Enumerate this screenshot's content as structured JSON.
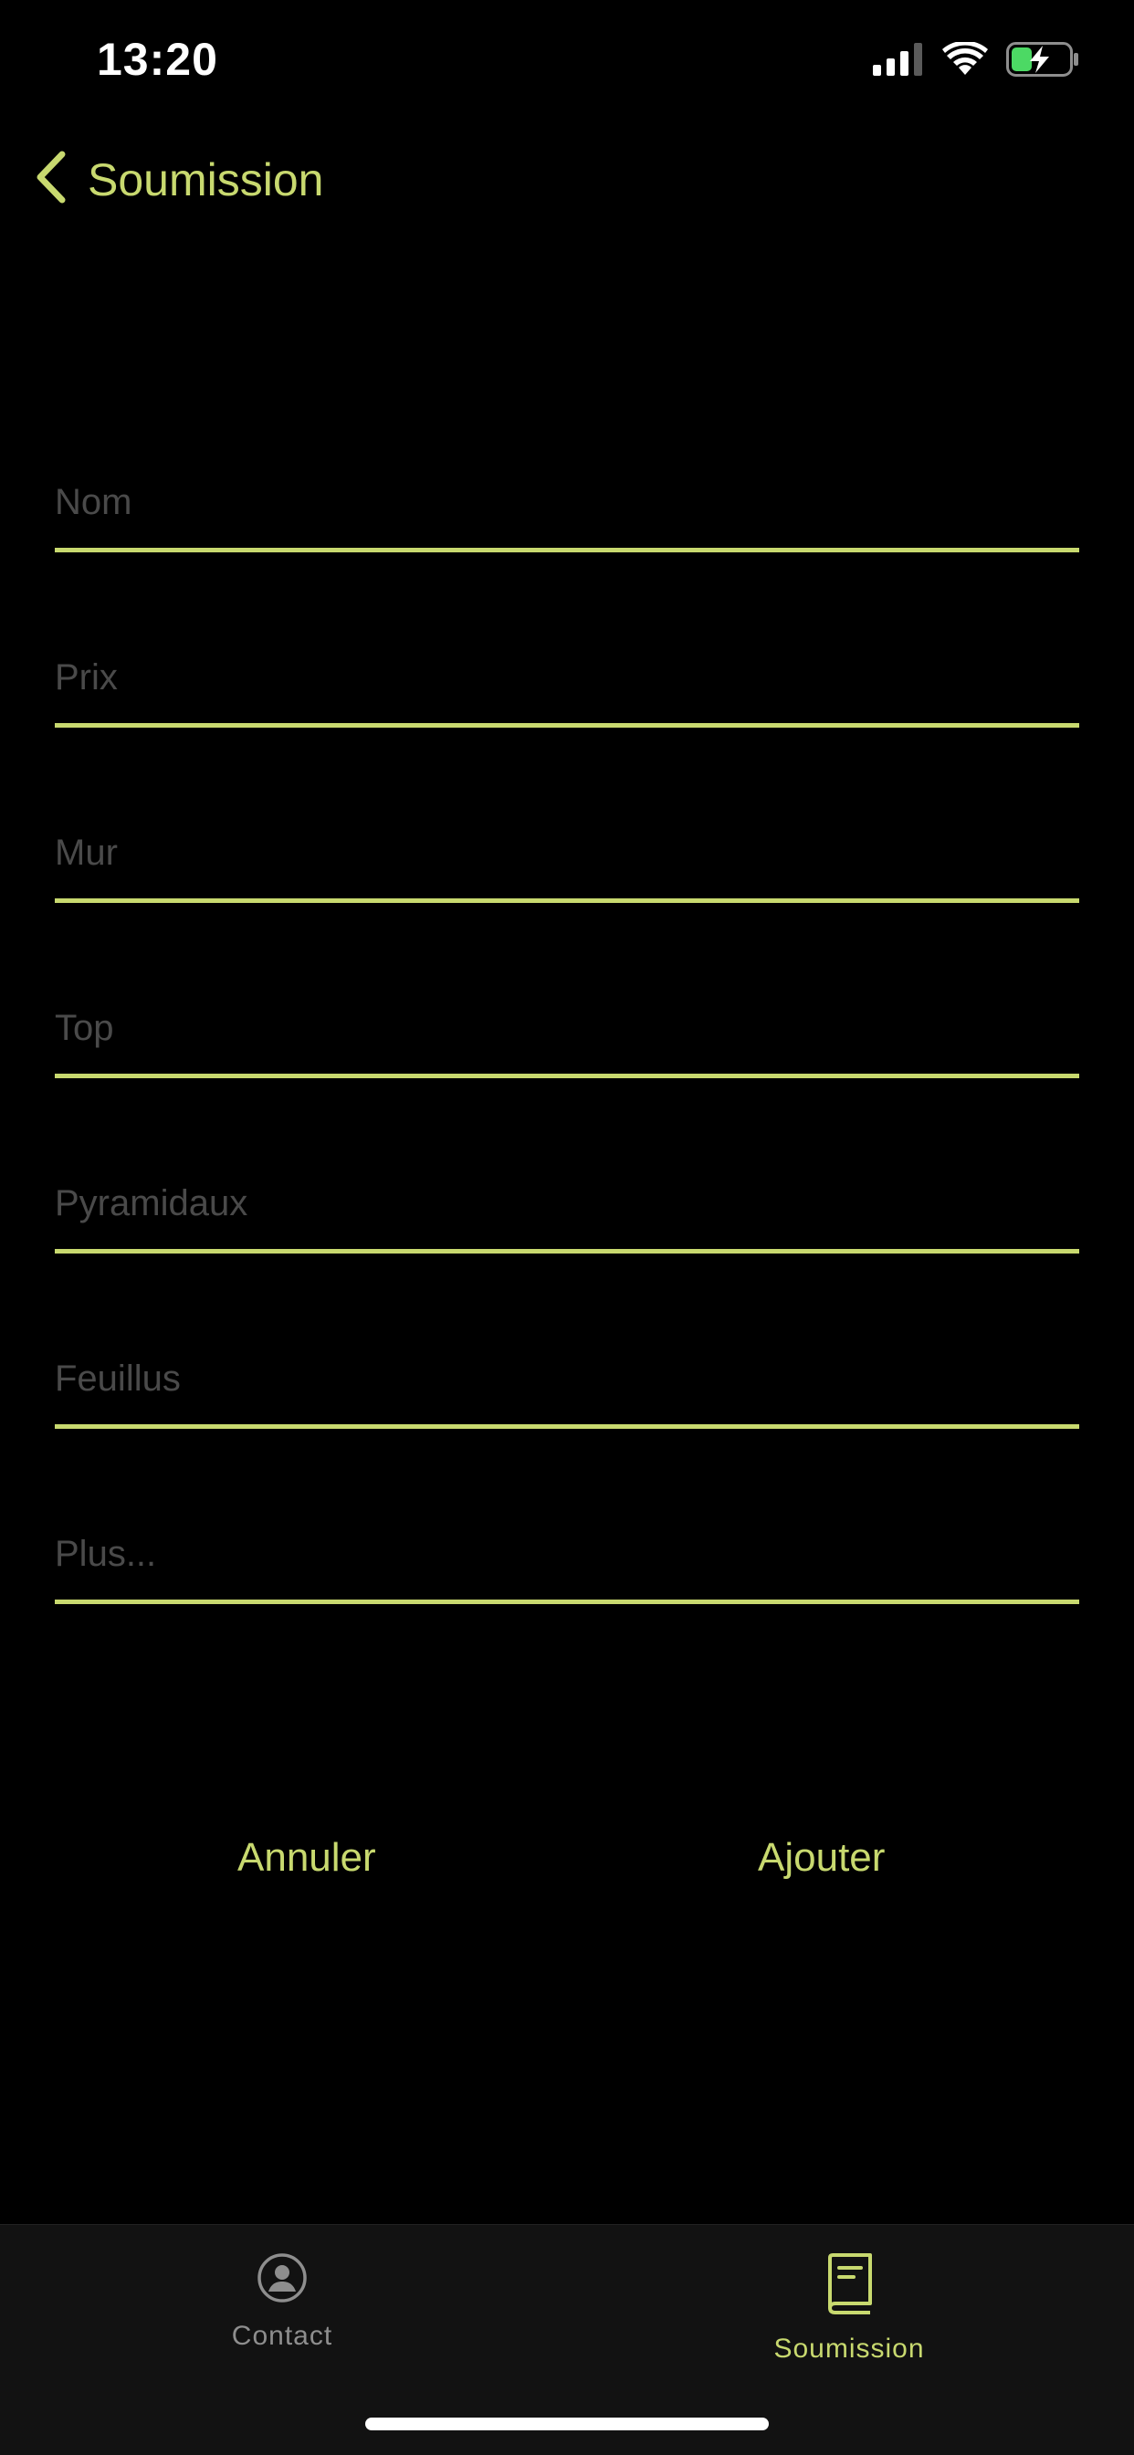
{
  "status_bar": {
    "time": "13:20",
    "icons": [
      "cellular-signal-icon",
      "wifi-icon",
      "battery-charging-icon"
    ]
  },
  "nav": {
    "back_label": "Soumission",
    "back_icon": "chevron-left-icon"
  },
  "form": {
    "fields": [
      {
        "placeholder": "Nom",
        "value": ""
      },
      {
        "placeholder": "Prix",
        "value": ""
      },
      {
        "placeholder": "Mur",
        "value": ""
      },
      {
        "placeholder": "Top",
        "value": ""
      },
      {
        "placeholder": "Pyramidaux",
        "value": ""
      },
      {
        "placeholder": "Feuillus",
        "value": ""
      },
      {
        "placeholder": "Plus...",
        "value": ""
      }
    ]
  },
  "actions": {
    "cancel_label": "Annuler",
    "add_label": "Ajouter"
  },
  "tabs": [
    {
      "label": "Contact",
      "icon": "person-circle-icon",
      "active": false
    },
    {
      "label": "Soumission",
      "icon": "book-icon",
      "active": true
    }
  ],
  "colors": {
    "accent": "#c8d96f",
    "background": "#000000",
    "tab_bar": "#121212",
    "placeholder": "#4a4a4a",
    "inactive_tab": "#8e8e8e",
    "battery_green": "#4cd964"
  }
}
